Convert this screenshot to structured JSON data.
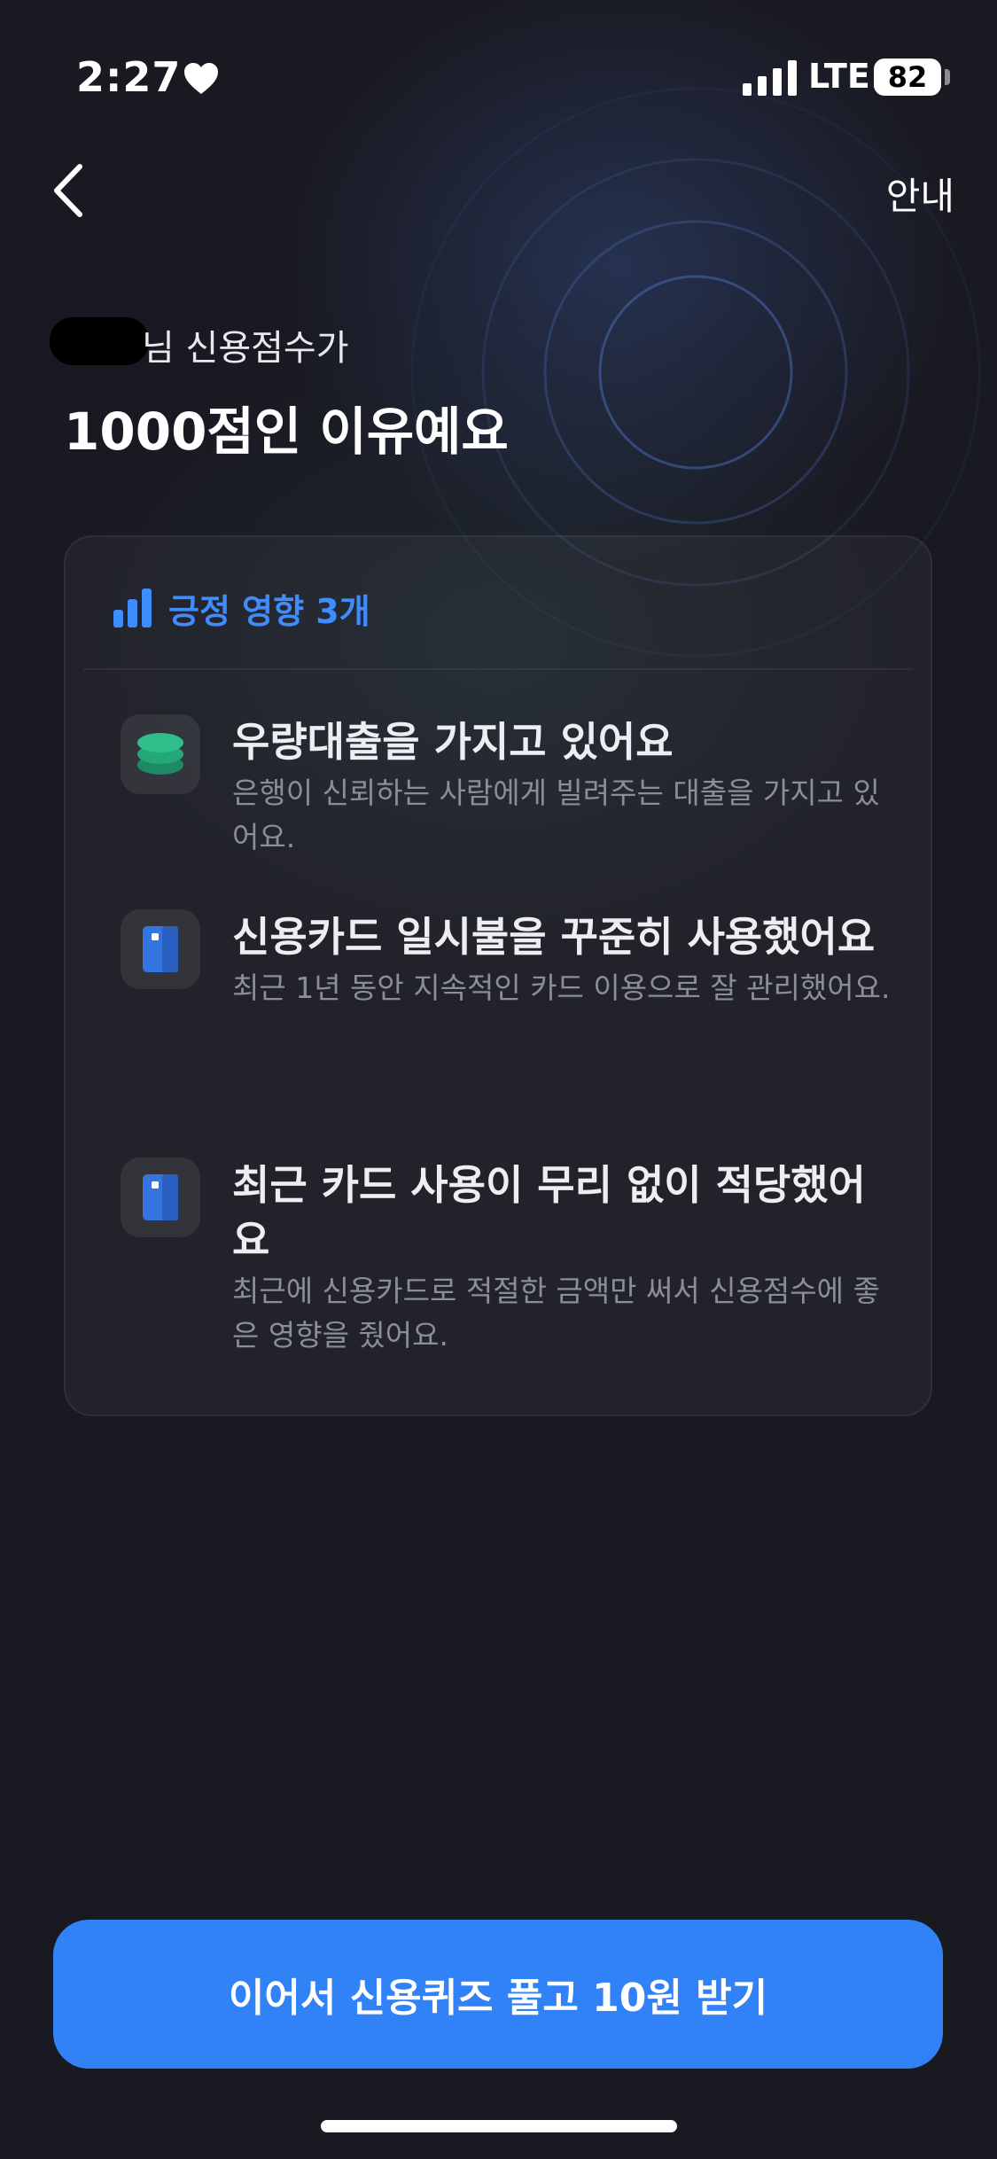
{
  "status_bar": {
    "time": "2:27",
    "network": "LTE",
    "battery": "82"
  },
  "nav": {
    "info_label": "안내"
  },
  "heading": {
    "subtitle_suffix": "님 신용점수가",
    "title": "1000점인 이유예요"
  },
  "card": {
    "header_label": "긍정 영향 3개",
    "factors": [
      {
        "icon": "coins-stack-icon",
        "title": "우량대출을 가지고 있어요",
        "description": "은행이 신뢰하는 사람에게 빌려주는 대출을 가지고 있어요."
      },
      {
        "icon": "credit-card-icon",
        "title": "신용카드 일시불을 꾸준히 사용했어요",
        "description": "최근 1년 동안 지속적인 카드 이용으로 잘 관리했어요."
      },
      {
        "icon": "credit-card-icon",
        "title": "최근 카드 사용이 무리 없이 적당했어요",
        "description": "최근에 신용카드로 적절한 금액만 써서 신용점수에 좋은 영향을 줬어요."
      }
    ]
  },
  "cta": {
    "label": "이어서 신용퀴즈 풀고 10원 받기"
  },
  "colors": {
    "background": "#191921",
    "accent": "#3182f6",
    "header_accent": "#3f8cff",
    "coin_green": "#2fbf8a"
  }
}
